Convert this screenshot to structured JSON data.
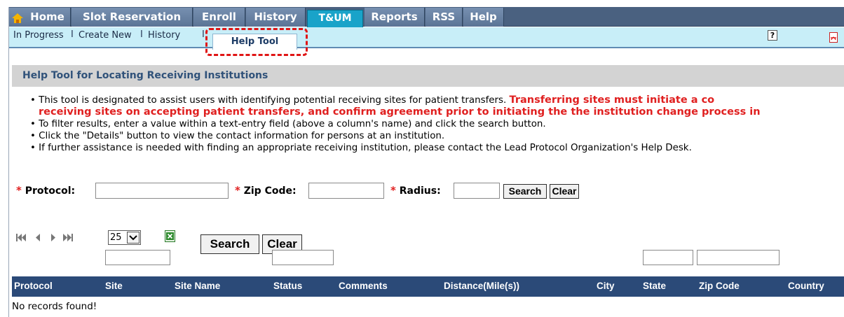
{
  "topnav": {
    "tabs": [
      {
        "label": "Home"
      },
      {
        "label": "Slot Reservation"
      },
      {
        "label": "Enroll"
      },
      {
        "label": "History"
      },
      {
        "label": "T&UM"
      },
      {
        "label": "Reports"
      },
      {
        "label": "RSS"
      },
      {
        "label": "Help"
      }
    ],
    "active_tab": "T&UM",
    "colors": {
      "bar": "#4a6180",
      "active": "#19a3c9"
    }
  },
  "subnav": {
    "links": [
      "In Progress",
      "Create New",
      "History"
    ],
    "separator": "I",
    "active_label": "Help Tool",
    "help_icon_label": "?"
  },
  "section": {
    "title": "Help Tool for Locating Receiving Institutions"
  },
  "instructions": {
    "line1_normal": "This tool is designated to assist users with identifying potential receiving sites for patient transfers. ",
    "line1_red": "Transferring sites must initiate a co",
    "line2_red": "receiving sites on accepting patient transfers, and confirm agreement prior to initiating the the institution change process in",
    "line3": "To filter results, enter a value within a text-entry field (above a column's name) and click the search button.",
    "line4": "Click the \"Details\" button to view the contact information for persons at an institution.",
    "line5": "If further assistance is needed with finding an appropriate receiving institution, please contact the Lead Protocol Organization's Help Desk.",
    "bullet": "•",
    "accent_color": "#e02020"
  },
  "form": {
    "required_marker": "*",
    "protocol_label": "Protocol:",
    "zip_label": "Zip Code:",
    "radius_label": "Radius:",
    "protocol_value": "",
    "zip_value": "",
    "radius_value": "",
    "search_label": "Search",
    "clear_label": "Clear"
  },
  "pager": {
    "page_size": "25",
    "search_label": "Search",
    "clear_label": "Clear"
  },
  "table": {
    "columns": [
      "Protocol",
      "Site",
      "Site Name",
      "Status",
      "Comments",
      "Distance(Mile(s))",
      "City",
      "State",
      "Zip Code",
      "Country"
    ],
    "empty_message": "No records found!",
    "header_color": "#2b4a78"
  }
}
